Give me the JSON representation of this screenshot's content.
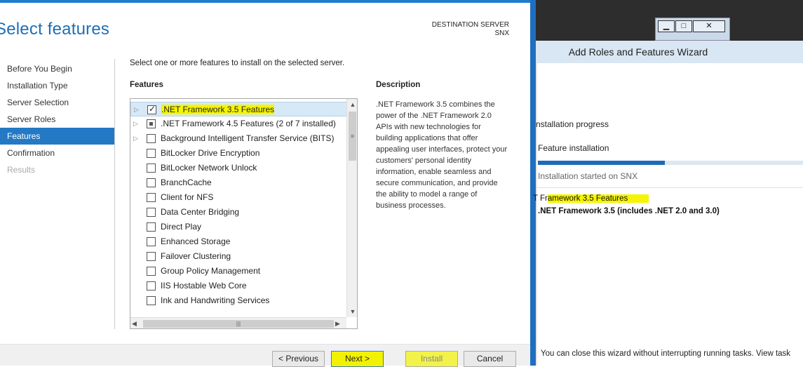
{
  "wizard": {
    "title": "Select features",
    "destination_label": "DESTINATION SERVER",
    "destination_server": "SNX",
    "nav_items": [
      {
        "label": "Before You Begin"
      },
      {
        "label": "Installation Type"
      },
      {
        "label": "Server Selection"
      },
      {
        "label": "Server Roles"
      },
      {
        "label": "Features"
      },
      {
        "label": "Confirmation"
      },
      {
        "label": "Results"
      }
    ],
    "instruction": "Select one or more features to install on the selected server.",
    "features_heading": "Features",
    "description_heading": "Description",
    "description_text": ".NET Framework 3.5 combines the power of the .NET Framework 2.0 APIs with new technologies for building applications that offer appealing user interfaces, protect your customers' personal identity information, enable seamless and secure communication, and provide the ability to model a range of business processes.",
    "features": [
      {
        "label": ".NET Framework 3.5 Features",
        "checked": true,
        "expandable": true
      },
      {
        "label": ".NET Framework 4.5 Features (2 of 7 installed)",
        "partial": true,
        "expandable": true
      },
      {
        "label": "Background Intelligent Transfer Service (BITS)",
        "expandable": true
      },
      {
        "label": "BitLocker Drive Encryption"
      },
      {
        "label": "BitLocker Network Unlock"
      },
      {
        "label": "BranchCache"
      },
      {
        "label": "Client for NFS"
      },
      {
        "label": "Data Center Bridging"
      },
      {
        "label": "Direct Play"
      },
      {
        "label": "Enhanced Storage"
      },
      {
        "label": "Failover Clustering"
      },
      {
        "label": "Group Policy Management"
      },
      {
        "label": "IIS Hostable Web Core"
      },
      {
        "label": "Ink and Handwriting Services"
      }
    ],
    "buttons": {
      "previous": "< Previous",
      "next": "Next >",
      "install": "Install",
      "cancel": "Cancel"
    }
  },
  "progress_window": {
    "title": "Add Roles and Features Wizard",
    "heading": "nstallation progress",
    "feature_installation": "Feature installation",
    "progress_fraction": 0.48,
    "status": "Installation started on SNX",
    "result_prefix": "T Fr",
    "result_title": "amework 3.5 Features",
    "result_detail": ".NET Framework 3.5 (includes .NET 2.0 and 3.0)",
    "close_note": "You can close this wizard without interrupting running tasks. View task"
  },
  "colors": {
    "accent": "#2479c5",
    "highlight": "#f5f500",
    "progress": "#1c6bb8"
  }
}
